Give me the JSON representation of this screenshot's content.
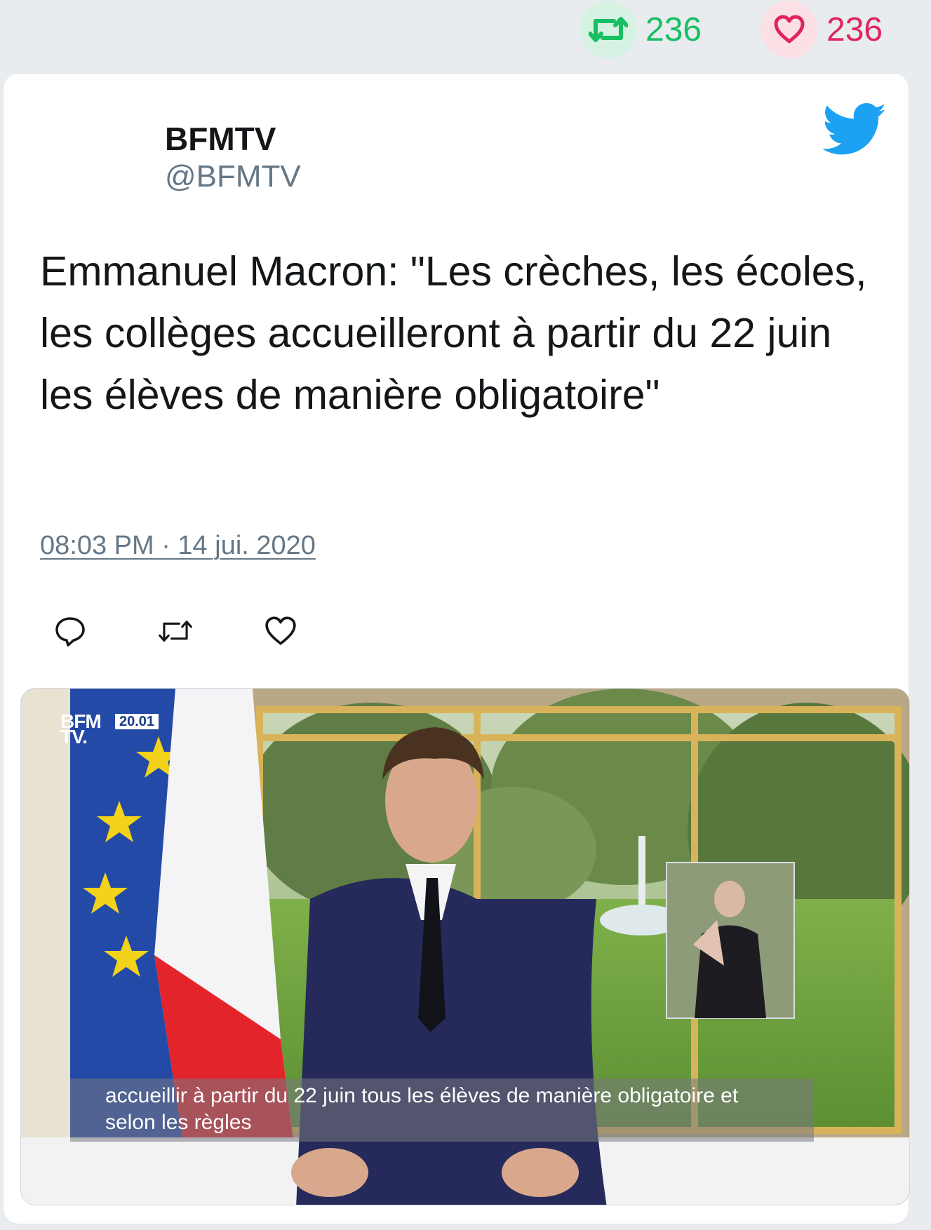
{
  "stats": {
    "retweets": "236",
    "likes": "236",
    "retweet_icon": "retweet-icon",
    "like_icon": "heart-icon",
    "retweet_color": "#17bf63",
    "like_color": "#e0245e"
  },
  "tweet": {
    "author_name": "BFMTV",
    "author_handle": "@BFMTV",
    "text": "Emmanuel Macron: \"Les crèches, les écoles, les collèges accueilleront à partir du 22 juin les élèves de manière obligatoire\"",
    "timestamp": "08:03 PM · 14 jui. 2020",
    "brand_icon": "twitter-bird-icon",
    "brand_color": "#1da1f2"
  },
  "actions": [
    {
      "icon": "reply-icon"
    },
    {
      "icon": "retweet-icon"
    },
    {
      "icon": "like-icon"
    }
  ],
  "media": {
    "channel_logo_line1": "BFM",
    "channel_logo_line2": "TV.",
    "broadcast_time": "20.01",
    "subtitle_line1": "accueillir à partir du 22 juin tous les élèves de manière obligatoire et",
    "subtitle_line2": "selon les règles"
  }
}
